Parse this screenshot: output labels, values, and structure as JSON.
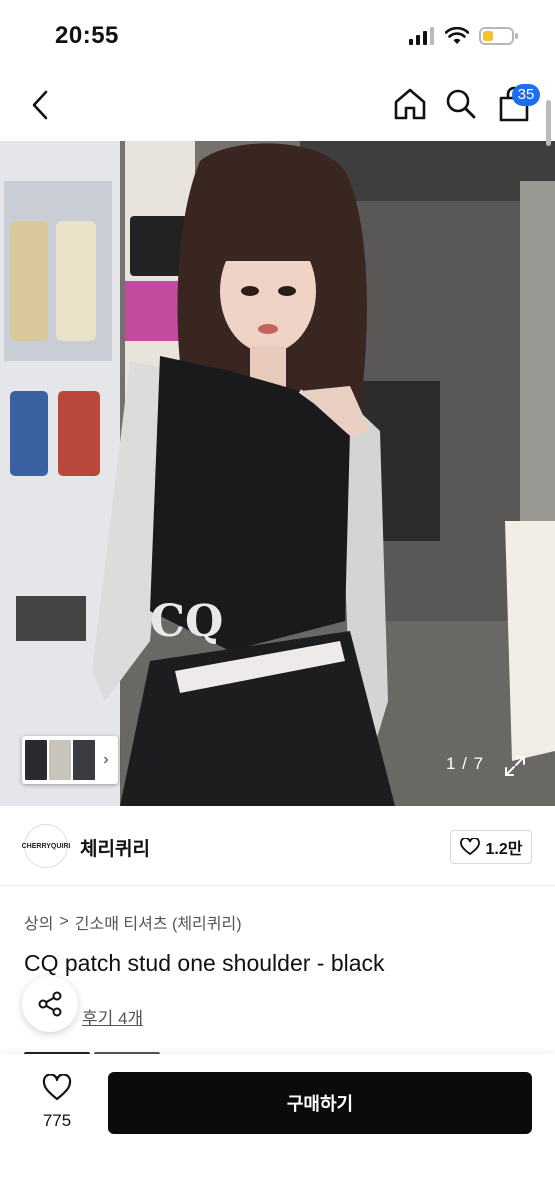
{
  "status": {
    "time": "20:55"
  },
  "nav": {
    "cart_count": "35"
  },
  "gallery": {
    "counter": "1 / 7"
  },
  "shop": {
    "logo_text": "CHERRYQUIRI",
    "name": "체리퀴리",
    "likes": "1.2만"
  },
  "breadcrumb": {
    "level1": "상의",
    "separator": ">",
    "level2": "긴소매 티셔츠 (체리퀴리)"
  },
  "product": {
    "title": "CQ patch stud one shoulder - black",
    "reviews": "후기 4개"
  },
  "bottom": {
    "wish_count": "775",
    "buy_label": "구매하기"
  },
  "colors": {
    "accent": "#1e6df0",
    "buy_button": "#0b0b0b"
  }
}
